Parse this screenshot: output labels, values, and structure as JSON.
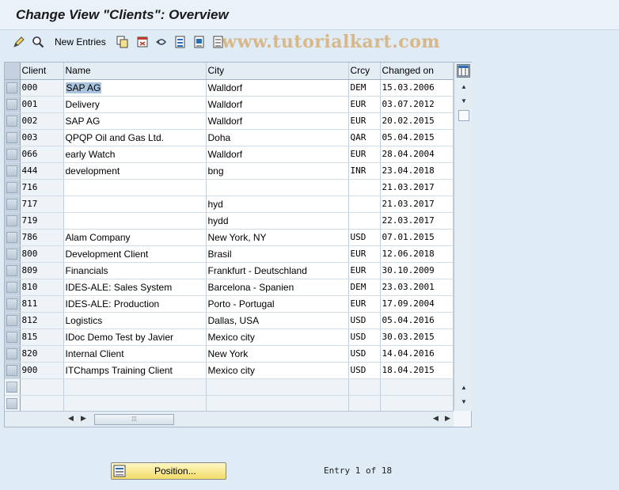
{
  "window": {
    "title": "Change View \"Clients\": Overview"
  },
  "toolbar": {
    "icons": [
      "edit-toggle-icon",
      "display-icon",
      "copy-icon",
      "delete-icon",
      "undo-icon",
      "select-all-icon",
      "select-block-icon",
      "deselect-all-icon"
    ],
    "new_entries_label": "New Entries",
    "watermark": "www.tutorialkart.com"
  },
  "grid": {
    "columns": [
      "Client",
      "Name",
      "City",
      "Crcy",
      "Changed on"
    ],
    "rows": [
      {
        "client": "000",
        "name": "SAP AG",
        "city": "Walldorf",
        "crcy": "DEM",
        "changed": "15.03.2006"
      },
      {
        "client": "001",
        "name": "Delivery",
        "city": "Walldorf",
        "crcy": "EUR",
        "changed": "03.07.2012"
      },
      {
        "client": "002",
        "name": "SAP AG",
        "city": "Walldorf",
        "crcy": "EUR",
        "changed": "20.02.2015"
      },
      {
        "client": "003",
        "name": "QPQP Oil and Gas Ltd.",
        "city": "Doha",
        "crcy": "QAR",
        "changed": "05.04.2015"
      },
      {
        "client": "066",
        "name": "early Watch",
        "city": "Walldorf",
        "crcy": "EUR",
        "changed": "28.04.2004"
      },
      {
        "client": "444",
        "name": "development",
        "city": "bng",
        "crcy": "INR",
        "changed": "23.04.2018"
      },
      {
        "client": "716",
        "name": "",
        "city": "",
        "crcy": "",
        "changed": "21.03.2017"
      },
      {
        "client": "717",
        "name": "",
        "city": "hyd",
        "crcy": "",
        "changed": "21.03.2017"
      },
      {
        "client": "719",
        "name": "",
        "city": "hydd",
        "crcy": "",
        "changed": "22.03.2017"
      },
      {
        "client": "786",
        "name": "Alam Company",
        "city": "New York, NY",
        "crcy": "USD",
        "changed": "07.01.2015"
      },
      {
        "client": "800",
        "name": "Development Client",
        "city": "Brasil",
        "crcy": "EUR",
        "changed": "12.06.2018"
      },
      {
        "client": "809",
        "name": "Financials",
        "city": "Frankfurt - Deutschland",
        "crcy": "EUR",
        "changed": "30.10.2009"
      },
      {
        "client": "810",
        "name": "IDES-ALE: Sales System",
        "city": "Barcelona - Spanien",
        "crcy": "DEM",
        "changed": "23.03.2001"
      },
      {
        "client": "811",
        "name": "IDES-ALE: Production",
        "city": "Porto - Portugal",
        "crcy": "EUR",
        "changed": "17.09.2004"
      },
      {
        "client": "812",
        "name": "Logistics",
        "city": "Dallas, USA",
        "crcy": "USD",
        "changed": "05.04.2016"
      },
      {
        "client": "815",
        "name": "IDoc Demo Test by Javier",
        "city": "Mexico city",
        "crcy": "USD",
        "changed": "30.03.2015"
      },
      {
        "client": "820",
        "name": "Internal Client",
        "city": "New York",
        "crcy": "USD",
        "changed": "14.04.2016"
      },
      {
        "client": "900",
        "name": "ITChamps Training Client",
        "city": "Mexico city",
        "crcy": "USD",
        "changed": "18.04.2015"
      }
    ]
  },
  "footer": {
    "position_label": "Position...",
    "entry_info": "Entry 1 of 18"
  },
  "colors": {
    "background": "#dfebf5",
    "button": "#f3dd6a",
    "selection": "#aac4dd"
  }
}
